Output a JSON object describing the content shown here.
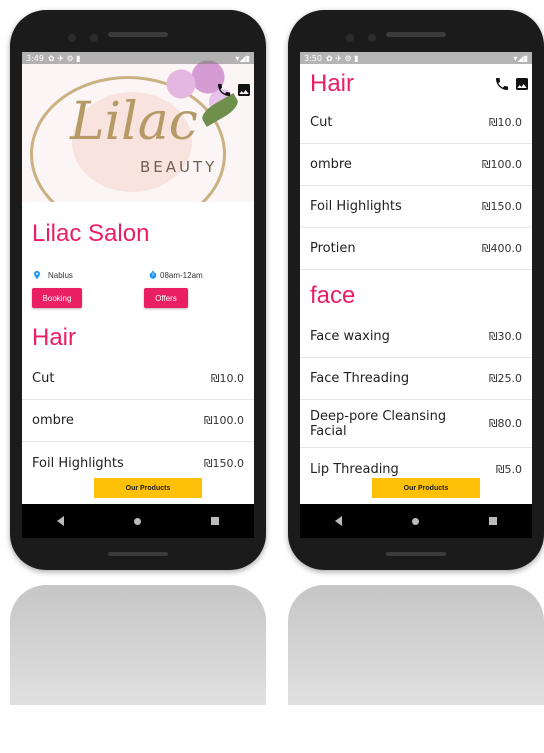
{
  "left_phone": {
    "status": {
      "time": "3:49",
      "icons": "✿ ✈ ⚙ ▮",
      "right": "▾◢▮"
    },
    "logo": {
      "script": "Lilac",
      "beauty": "BEAUTY"
    },
    "salon": {
      "title": "Lilac Salon",
      "location": "Nablus",
      "hours": "08am-12am"
    },
    "buttons": {
      "booking": "Booking",
      "offers": "Offers"
    },
    "section": {
      "title": "Hair"
    },
    "items": [
      {
        "name": "Cut",
        "price": "₪10.0"
      },
      {
        "name": "ombre",
        "price": "₪100.0"
      },
      {
        "name": "Foil Highlights",
        "price": "₪150.0"
      }
    ],
    "products_button": "Our Products"
  },
  "right_phone": {
    "status": {
      "time": "3:50",
      "icons": "✿ ✈ ⚙ ▮",
      "right": "▾◢▮"
    },
    "hair": {
      "title": "Hair",
      "items": [
        {
          "name": "Cut",
          "price": "₪10.0"
        },
        {
          "name": "ombre",
          "price": "₪100.0"
        },
        {
          "name": "Foil Highlights",
          "price": "₪150.0"
        },
        {
          "name": "Protien",
          "price": "₪400.0"
        }
      ]
    },
    "face": {
      "title": "face",
      "items": [
        {
          "name": "Face waxing",
          "price": "₪30.0"
        },
        {
          "name": "Face Threading",
          "price": "₪25.0"
        },
        {
          "name": "Deep-pore Cleansing Facial",
          "price": "₪80.0"
        },
        {
          "name": "Lip Threading",
          "price": "₪5.0"
        }
      ]
    },
    "products_button": "Our Products"
  },
  "colors": {
    "accent": "#e91e63",
    "products": "#ffc107",
    "location_icon": "#2196f3"
  }
}
